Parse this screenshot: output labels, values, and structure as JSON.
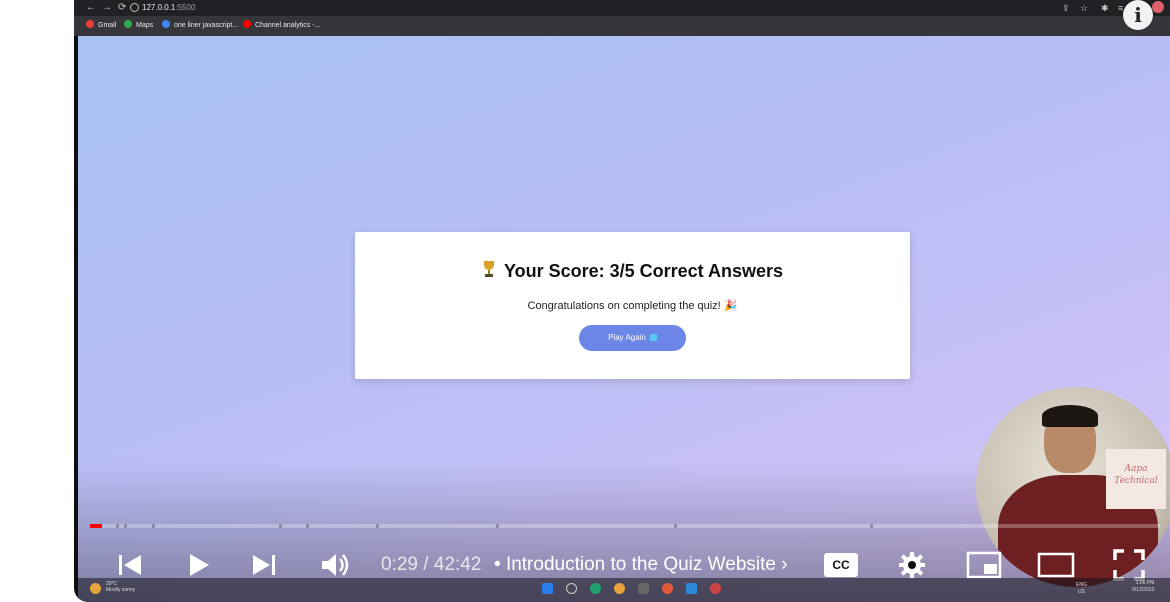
{
  "browser": {
    "url_host": "127.0.0.1",
    "url_port": ":5500",
    "bookmarks": [
      {
        "label": "Gmail",
        "color": "#ea4335"
      },
      {
        "label": "Maps",
        "color": "#34a853"
      },
      {
        "label": "one liner javascript...",
        "color": "#4285f4"
      },
      {
        "label": "Channel analytics -...",
        "color": "#ff0000"
      }
    ],
    "profile_initial": "i"
  },
  "quiz": {
    "score_text": "Your Score: 3/5 Correct Answers",
    "congrats_text": "Congratulations on completing the quiz! 🎉",
    "play_again_label": "Play Again",
    "button_color": "#6b86e6"
  },
  "webcam": {
    "logo_text": "Aapa Technical"
  },
  "player": {
    "time": "0:29 / 42:42",
    "separator": "•",
    "chapter": "Introduction to the Quiz Website",
    "chapter_chevron": "›",
    "cc_label": "CC",
    "progress_fraction": 0.011,
    "played_color": "#ff0000"
  },
  "taskbar": {
    "weather_temp": "29°C",
    "weather_desc": "Mostly sunny",
    "time": "1:06 PM",
    "date": "9/13/2023",
    "lang": "ENG",
    "region": "US"
  }
}
